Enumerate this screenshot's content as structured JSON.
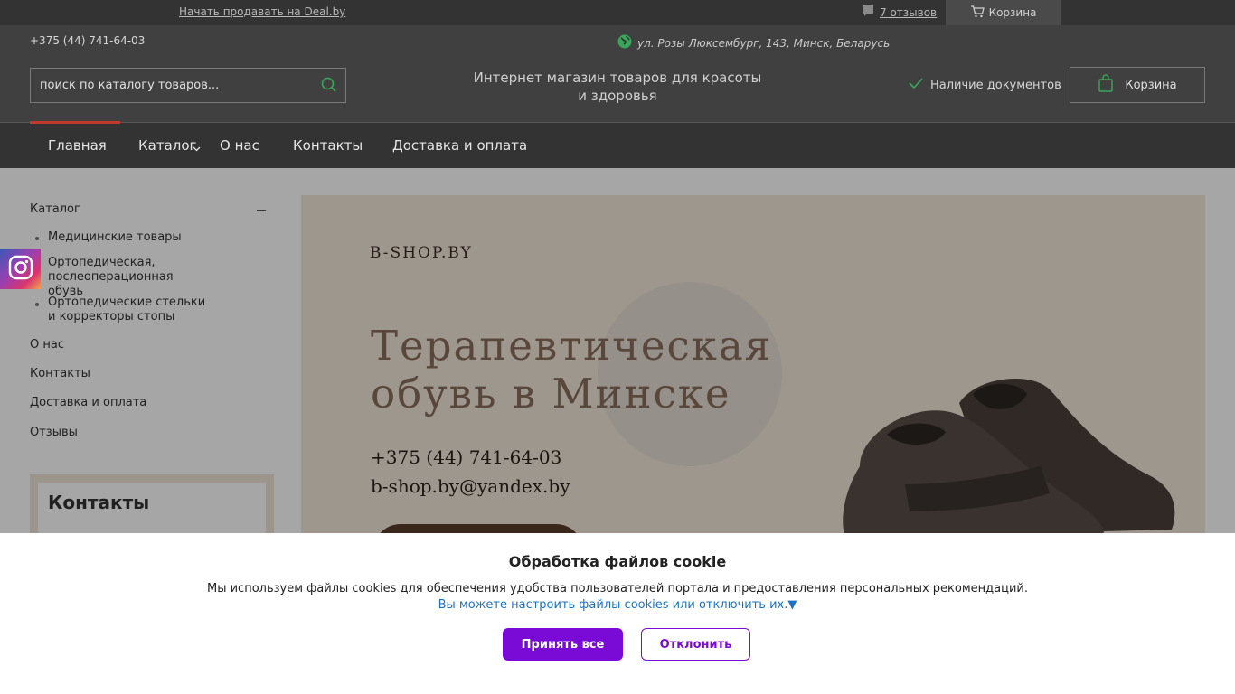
{
  "topbar": {
    "sell_link": "Начать продавать на Deal.by",
    "reviews_link": "7 отзывов",
    "cart_label": "Корзина"
  },
  "header": {
    "phone": "+375 (44) 741-64-03",
    "address": "ул. Розы Люксембург, 143, Минск, Беларусь",
    "search_placeholder": "поиск по каталогу товаров...",
    "tagline_line1": "Интернет магазин товаров для красоты",
    "tagline_line2": "и здоровья",
    "docs_label": "Наличие документов",
    "cart_label": "Корзина"
  },
  "nav": {
    "items": [
      "Главная",
      "Каталог",
      "О нас",
      "Контакты",
      "Доставка и оплата"
    ]
  },
  "sidebar": {
    "catalog_label": "Каталог",
    "sub_items": [
      "Медицинские товары",
      "Ортопедическая, послеоперационная обувь",
      "Ортопедические стельки и корректоры стопы"
    ],
    "links": [
      "О нас",
      "Контакты",
      "Доставка и оплата",
      "Отзывы"
    ],
    "contacts_title": "Контакты"
  },
  "banner": {
    "logo": "B-SHOP.BY",
    "heading_line1": "Терапевтическая",
    "heading_line2": "обувь в Минске",
    "phone": "+375 (44) 741-64-03",
    "email": "b-shop.by@yandex.by"
  },
  "cookie": {
    "title": "Обработка файлов cookie",
    "text": "Мы используем файлы cookies для обеспечения удобства пользователей портала и предоставления персональных рекомендаций.",
    "settings_link": "Вы можете настроить файлы cookies или отключить их.▼",
    "accept_label": "Принять все",
    "decline_label": "Отклонить"
  },
  "colors": {
    "accent_purple": "#7a0bd6",
    "nav_active": "#c0392b",
    "header_bg": "#404040"
  },
  "icons": [
    "comment-icon",
    "cart-icon",
    "globe-icon",
    "search-icon",
    "check-icon",
    "bag-icon",
    "chevron-down-icon",
    "instagram-icon"
  ]
}
